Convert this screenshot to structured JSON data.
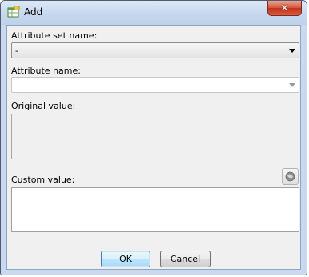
{
  "window": {
    "title": "Add",
    "close_glyph": "✕"
  },
  "form": {
    "attribute_set_label": "Attribute set name:",
    "attribute_set_value": "-",
    "attribute_name_label": "Attribute name:",
    "attribute_name_value": "",
    "original_value_label": "Original value:",
    "original_value": "",
    "custom_value_label": "Custom value:",
    "custom_value": "",
    "custom_value_tool_icon": "globe-icon"
  },
  "buttons": {
    "ok_label": "OK",
    "cancel_label": "Cancel"
  }
}
